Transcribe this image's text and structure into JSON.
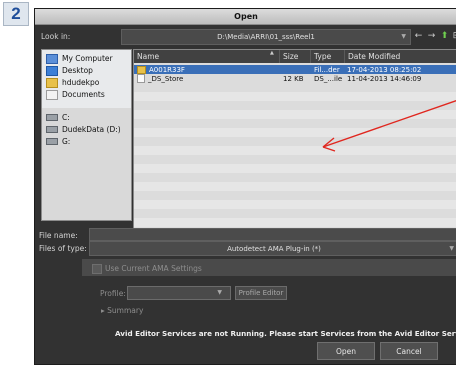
{
  "step_number": "2",
  "dialog": {
    "title": "Open",
    "look_in_label": "Look in:",
    "look_in_value": "D:\\Media\\ARRI\\01_sss\\Reel1",
    "nav_icons": [
      "dropdown-icon",
      "back-arrow-icon",
      "forward-arrow-icon",
      "up-folder-icon",
      "new-folder-icon",
      "view-menu-icon"
    ]
  },
  "sidebar": {
    "items": [
      {
        "label": "My Computer",
        "icon": "computer-icon"
      },
      {
        "label": "Desktop",
        "icon": "desktop-icon"
      },
      {
        "label": "hdudekpo",
        "icon": "user-folder-icon"
      },
      {
        "label": "Documents",
        "icon": "documents-icon"
      },
      {
        "label": "C:",
        "icon": "drive-icon"
      },
      {
        "label": "DudekData (D:)",
        "icon": "drive-icon"
      },
      {
        "label": "G:",
        "icon": "drive-icon"
      }
    ]
  },
  "file_list": {
    "columns": [
      "Name",
      "Size",
      "Type",
      "Date Modified"
    ],
    "rows": [
      {
        "name": "A001R33F",
        "size": "",
        "type": "Fil...der",
        "date": "17-04-2013 08:25:02",
        "icon": "folder-icon",
        "selected": true
      },
      {
        "name": "_DS_Store",
        "size": "12 KB",
        "type": "DS_...ile",
        "date": "11-04-2013 14:46:09",
        "icon": "file-icon",
        "selected": false
      }
    ]
  },
  "file_name": {
    "label": "File name:",
    "value": ""
  },
  "files_of_type": {
    "label": "Files of type:",
    "value": "Autodetect AMA Plug-in (*)"
  },
  "ama": {
    "use_current_label": "Use Current AMA Settings",
    "profile_label": "Profile:",
    "profile_editor_label": "Profile Editor",
    "summary_label": "Summary"
  },
  "warning_text": "Avid Editor Services are not Running. Please start Services from the Avid Editor Services Manager",
  "buttons": {
    "open": "Open",
    "cancel": "Cancel"
  },
  "colors": {
    "annotation_arrow": "#e0271f",
    "selection": "#3a6fb8",
    "step_badge_text": "#1f4e9a"
  }
}
